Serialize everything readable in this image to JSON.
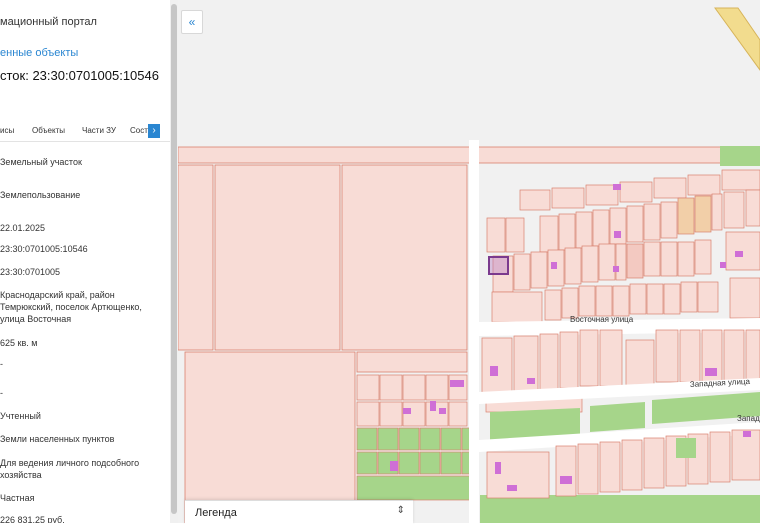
{
  "panel": {
    "portal_title": "мационный портал",
    "link": "енные объекты",
    "parcel_title": "сток: 23:30:0701005:10546",
    "tabs": [
      "исы",
      "Объекты",
      "Части ЗУ",
      "Состе"
    ],
    "fields": [
      "Земельный участок",
      "Землепользование",
      "22.01.2025",
      "23:30:0701005:10546",
      "23:30:0701005",
      "Краснодарский край, район",
      "Темрюкский, поселок Артющенко,",
      "улица Восточная",
      "625 кв. м",
      "-",
      "-",
      "Учтенный",
      "Земли населенных пунктов",
      "Для ведения личного подсобного",
      "хозяйства",
      "Частная",
      "226 831,25 руб."
    ]
  },
  "map": {
    "street_labels": [
      "Восточная улица",
      "Западная улица",
      "Западна"
    ],
    "colors": {
      "parcel_fill": "#f8dcd6",
      "parcel_line": "#d9806e",
      "green": "#a6d58a",
      "building": "#cf6fd6",
      "selected": "#7b3a8e",
      "road": "#ffffff",
      "yellow_road": "#f2dc8e"
    }
  },
  "legend": {
    "label": "Легенда"
  },
  "icons": {
    "collapse": "double-chevron-left-icon",
    "legend_toggle": "chevron-updown-icon",
    "tab_next": "chevron-right-icon"
  }
}
